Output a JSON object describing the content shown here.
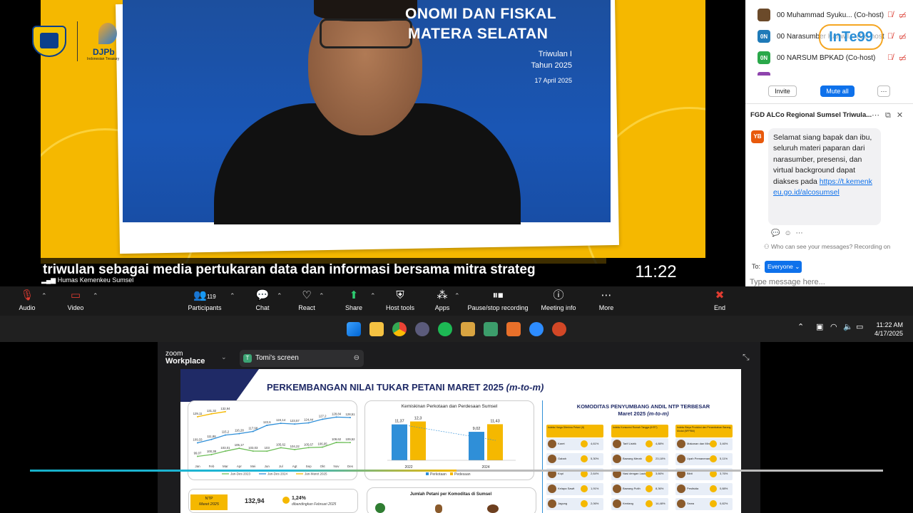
{
  "video": {
    "slide_title_lines": [
      "ONOMI DAN FISKAL",
      "MATERA SELATAN"
    ],
    "slide_period": "Triwulan I",
    "slide_year": "Tahun 2025",
    "slide_date": "17 April 2025",
    "caption": "triwulan sebagai media pertukaran data dan informasi bersama mitra strateg",
    "clock": "11:22",
    "speaker_name": "Humas Kemenkeu Sumsel",
    "logo_djpb": "DJPb",
    "logo_djpb_tag": "Indonesian Treasury"
  },
  "participants": {
    "items": [
      {
        "avatar": "",
        "color": "#6b4a2a",
        "name": "00 Muhammad Syuku... (Co-host)"
      },
      {
        "avatar": "0N",
        "color": "#1f7ab8",
        "name": "00 Narasumber Kanwil... (Co-host)"
      },
      {
        "avatar": "0N",
        "color": "#2aa84a",
        "name": "00 NARSUM BPKAD (Co-host)"
      }
    ],
    "overlay_logo": "InTe99",
    "invite_label": "Invite",
    "mute_all_label": "Mute all",
    "more_label": "···"
  },
  "chat": {
    "title": "FGD ALCo Regional Sumsel Triwula...",
    "sender_initials": "YB",
    "message_text": "Selamat siang bapak dan ibu,\nseluruh materi paparan dari narasumber, presensi, dan virtual background dapat diakses pada ",
    "message_link": "https://t.kemenkeu.go.id/alcosumsel",
    "privacy_note": "Who can see your messages? Recording on",
    "to_label": "To:",
    "to_value": "Everyone",
    "input_placeholder": "Type message here..."
  },
  "toolbar": {
    "audio": "Audio",
    "video": "Video",
    "participants": "Participants",
    "participants_count": "119",
    "chat": "Chat",
    "react": "React",
    "share": "Share",
    "host_tools": "Host tools",
    "apps": "Apps",
    "recording": "Pause/stop recording",
    "meeting_info": "Meeting info",
    "more": "More",
    "end": "End"
  },
  "taskbar": {
    "time": "11:22 AM",
    "date": "4/17/2025"
  },
  "share": {
    "app_name_top": "zoom",
    "app_name": "Workplace",
    "screen_tab": "Tomi's screen",
    "screen_tab_initial": "T"
  },
  "slide": {
    "heading": "PERKEMBANGAN NILAI TUKAR PETANI MARET 2025",
    "heading_suffix": "(m-to-m)",
    "komoditas_title": "KOMODITAS PENYUMBANG ANDIL NTP TERBESAR",
    "komoditas_subtitle": "Maret 2025",
    "komoditas_subtitle_suffix": "(m-to-m)",
    "col_headers": [
      "Indeks Harga Diterima Petani (It)",
      "Indeks Konsumsi Rumah Tangga (IKRT)",
      "Indeks Biaya Produksi dan Penambahan Barang Modal (BPPBM)"
    ],
    "col1": [
      [
        "Karet",
        "4,61%"
      ],
      [
        "Gabah",
        "5,30%"
      ],
      [
        "Kopi",
        "2,64%"
      ],
      [
        "Kelapa Sawit",
        "1,91%"
      ],
      [
        "Jagung",
        "2,06%"
      ]
    ],
    "col2": [
      [
        "Tarif Listrik",
        "4,88%"
      ],
      [
        "Bawang Merah",
        "23,18%"
      ],
      [
        "Nasi dengan Lauk",
        "3,66%"
      ],
      [
        "Bawang Putih",
        "8,36%"
      ],
      [
        "Kentang",
        "14,48%"
      ]
    ],
    "col3": [
      [
        "Makanan dan Minuman",
        "3,46%"
      ],
      [
        "Upah Pemanenan",
        "5,11%"
      ],
      [
        "Bibit",
        "3,76%"
      ],
      [
        "Pestisida",
        "0,88%"
      ],
      [
        "Sewa",
        "0,82%"
      ]
    ],
    "ntp_label_top": "NTP",
    "ntp_label_bottom": "Maret 2025",
    "ntp_value": "132,94",
    "ntp_change": "1,24%",
    "ntp_compare": "dibandingkan Februari 2025",
    "jumlah_petani_title": "Jumlah Petani  per Komoditas di Sumsel",
    "kemiskinan_title": "Kemiskinan Perkotaan dan Perdesaan Sumsel"
  },
  "chart_data": [
    {
      "type": "line",
      "title": "",
      "categories": [
        "Jan",
        "Feb",
        "Mar",
        "Apr",
        "Mei",
        "Jun",
        "Jul",
        "Agt",
        "Sep",
        "Okt",
        "Nov",
        "Des"
      ],
      "series": [
        {
          "name": "Jan-Des 2023",
          "color": "#6fbf5a",
          "values": [
            99.07,
            100.38,
            103.01,
            105.17,
            103.03,
            103.0,
            105.62,
            104.22,
            105.67,
            106.05,
            109.62,
            109.52
          ]
        },
        {
          "name": "Jan-Des 2024",
          "color": "#2f8fd8",
          "values": [
            109.33,
            111.88,
            115.2,
            116.28,
            117.98,
            122.6,
            124.14,
            123.57,
            124.44,
            127.2,
            128.84,
            128.51
          ]
        },
        {
          "name": "Jan-Maret 2025",
          "color": "#f5b800",
          "values": [
            129.11,
            131.32,
            132.94
          ]
        }
      ],
      "ylim": [
        95,
        135
      ]
    },
    {
      "type": "bar",
      "title": "Kemiskinan Perkotaan dan Perdesaan Sumsel",
      "categories": [
        "2022",
        "2024"
      ],
      "series": [
        {
          "name": "Perkotaan",
          "color": "#2f8fd8",
          "values": [
            11.37,
            9.02
          ]
        },
        {
          "name": "Pedesaan",
          "color": "#f5b800",
          "values": [
            12.3,
            11.43
          ]
        }
      ],
      "data_labels": [
        "11,37",
        "12,3",
        "9,02",
        "11,43"
      ],
      "ylim": [
        0,
        14
      ]
    }
  ],
  "playback": {
    "progress_fraction": 0.5
  }
}
